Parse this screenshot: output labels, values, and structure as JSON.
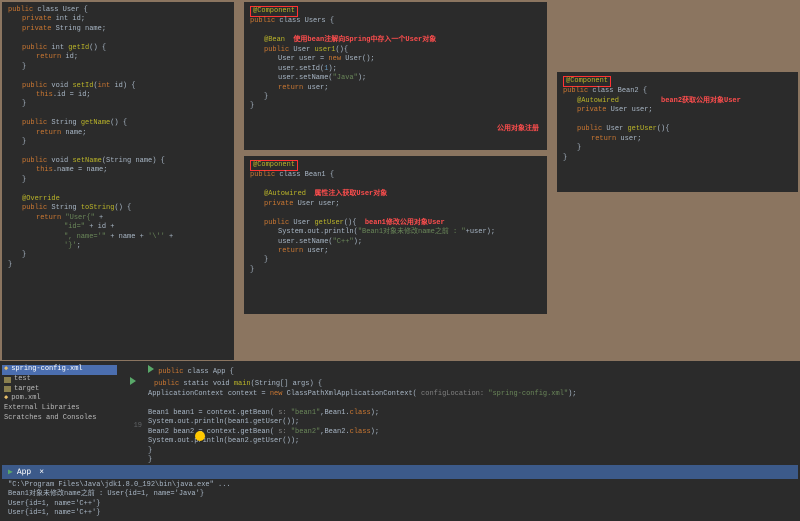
{
  "panel1": {
    "l1a": "public",
    "l1b": " class ",
    "l1c": "User {",
    "l2a": "private",
    "l2b": " int ",
    "l2c": "id;",
    "l3a": "private",
    "l3b": " String ",
    "l3c": "name;",
    "l4a": "public",
    "l4b": " int ",
    "l4c": "getId",
    "l4d": "() {",
    "l5a": "return",
    "l5b": " id;",
    "l6": "}",
    "l7a": "public",
    "l7b": " void ",
    "l7c": "setId",
    "l7d": "(",
    "l7e": "int",
    "l7f": " id) {",
    "l8a": "this",
    "l8b": ".id = id;",
    "l9": "}",
    "l10a": "public",
    "l10b": " String ",
    "l10c": "getName",
    "l10d": "() {",
    "l11a": "return",
    "l11b": " name;",
    "l12": "}",
    "l13a": "public",
    "l13b": " void ",
    "l13c": "setName",
    "l13d": "(String name) {",
    "l14a": "this",
    "l14b": ".name = name;",
    "l15": "}",
    "l16": "@Override",
    "l17a": "public",
    "l17b": " String ",
    "l17c": "toString",
    "l17d": "() {",
    "l18a": "return",
    "l18b": " \"User{\"",
    "l18c": " +",
    "l19a": "\"id=\"",
    "l19b": " + id +",
    "l20a": "\", name='\"",
    "l20b": " + name + ",
    "l20c": "'\\''",
    "l20d": " +",
    "l21a": "'}'",
    "l21b": ";",
    "l22": "}",
    "l23": "}"
  },
  "panel2": {
    "l1": "@Component",
    "l2a": "public",
    "l2b": " class ",
    "l2c": "Users {",
    "l3": "@Bean",
    "l3note": "使用bean注解向Spring中存入一个User对象",
    "l4a": "public",
    "l4b": " User ",
    "l4c": "user1",
    "l4d": "(){",
    "l5a": "User user = ",
    "l5b": "new",
    "l5c": " User();",
    "l6a": "user.setId(",
    "l6b": "1",
    "l6c": ");",
    "l7a": "user.setName(",
    "l7b": "\"Java\"",
    "l7c": ");",
    "l8a": "return",
    "l8b": " user;",
    "l9": "}",
    "l10": "}",
    "note2": "公用对象注册"
  },
  "panel3": {
    "l1": "@Component",
    "l2a": "public",
    "l2b": " class ",
    "l2c": "Bean1 {",
    "l3": "@Autowired",
    "l3note": "属性注入获取User对象",
    "l4a": "private",
    "l4b": " User ",
    "l4c": "user;",
    "l5a": "public",
    "l5b": " User ",
    "l5c": "getUser",
    "l5d": "(){",
    "l5note": "bean1修改公用对象User",
    "l6a": "System.out.println(",
    "l6b": "\"Bean1对象未修改name之前 : \"",
    "l6c": "+user);",
    "l7a": "user.setName(",
    "l7b": "\"C++\"",
    "l7c": ");",
    "l8a": "return",
    "l8b": " user;",
    "l9": "}",
    "l10": "}"
  },
  "panel4": {
    "l1": "@Component",
    "l2a": "public",
    "l2b": " class ",
    "l2c": "Bean2 {",
    "l3": "@Autowired",
    "l3note": "bean2获取公用对象User",
    "l4a": "private",
    "l4b": " User ",
    "l4c": "user;",
    "l5a": "public",
    "l5b": " User ",
    "l5c": "getUser",
    "l5d": "(){",
    "l6a": "return",
    "l6b": " user;",
    "l7": "}",
    "l8": "}"
  },
  "tree": {
    "i1": "spring-config.xml",
    "i2": "test",
    "i3": "target",
    "i4": "pom.xml",
    "i5": "External Libraries",
    "i6": "Scratches and Consoles"
  },
  "app": {
    "l1a": "public",
    "l1b": " class ",
    "l1c": "App {",
    "l2a": "public",
    "l2b": " static void ",
    "l2c": "main",
    "l2d": "(String[] args) {",
    "l3a": "ApplicationContext context = ",
    "l3b": "new",
    "l3c": " ClassPathXmlApplicationContext(",
    "l3d": " configLocation: ",
    "l3e": "\"spring-config.xml\"",
    "l3f": ");",
    "l4a": "Bean1 bean1 = context.getBean(",
    "l4b": " s: ",
    "l4c": "\"bean1\"",
    "l4d": ",Bean1.",
    "l4e": "class",
    "l4f": ");",
    "l5": "System.out.println(bean1.getUser());",
    "g19": "19",
    "l6a": "Bean2 bean2 = context.getBean(",
    "l6b": " s: ",
    "l6c": "\"bean2\"",
    "l6d": ",Bean2.",
    "l6e": "class",
    "l6f": ");",
    "l7": "System.out.println(bean2.getUser());",
    "l8": "}",
    "l9": "}"
  },
  "run": {
    "tab": "App"
  },
  "console": {
    "l1": "\"C:\\Program Files\\Java\\jdk1.8.0_192\\bin\\java.exe\" ...",
    "l2": "Bean1对象未修改name之前 : User{id=1, name='Java'}",
    "l3": "User{id=1, name='C++'}",
    "l4": "User{id=1, name='C++'}"
  }
}
